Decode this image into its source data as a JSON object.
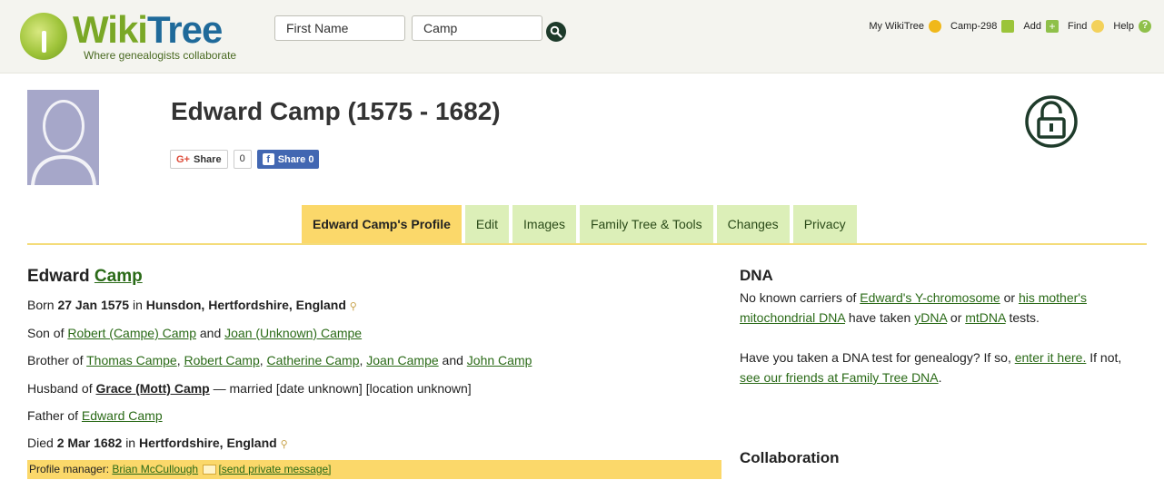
{
  "header": {
    "logo_text_wiki": "Wiki",
    "logo_text_tree": "Tree",
    "logo_tagline": "Where genealogists collaborate",
    "search": {
      "first_name_value": "First Name",
      "last_name_value": "Camp"
    },
    "nav": {
      "my_wikitree": "My WikiTree",
      "user": "Camp-298",
      "add": "Add",
      "find": "Find",
      "help": "Help"
    }
  },
  "profile": {
    "title": "Edward Camp (1575 - 1682)",
    "share": {
      "google_label": "Share",
      "google_count": "0",
      "facebook_label": "Share 0"
    }
  },
  "tabs": [
    {
      "label": "Edward Camp's Profile",
      "active": true
    },
    {
      "label": "Edit"
    },
    {
      "label": "Images"
    },
    {
      "label": "Family Tree & Tools"
    },
    {
      "label": "Changes"
    },
    {
      "label": "Privacy"
    }
  ],
  "person": {
    "first_name": "Edward",
    "last_name": "Camp",
    "born": {
      "prefix": "Born",
      "date": "27 Jan 1575",
      "in": "in",
      "place": "Hunsdon, Hertfordshire, England"
    },
    "son_of": {
      "prefix": "Son of",
      "father": "Robert (Campe) Camp",
      "and": "and",
      "mother": "Joan (Unknown) Campe"
    },
    "brother_of": {
      "prefix": "Brother of",
      "siblings": [
        "Thomas Campe",
        "Robert Camp",
        "Catherine Camp",
        "Joan Campe",
        "John Camp"
      ],
      "and": "and"
    },
    "husband_of": {
      "prefix": "Husband of",
      "spouse": "Grace (Mott) Camp",
      "details": "— married [date unknown] [location unknown]"
    },
    "father_of": {
      "prefix": "Father of",
      "child": "Edward Camp"
    },
    "died": {
      "prefix": "Died",
      "date": "2 Mar 1682",
      "in": "in",
      "place": "Hertfordshire, England"
    },
    "manager": {
      "prefix": "Profile manager:",
      "name": "Brian McCullough",
      "message_link": "[send private message]"
    }
  },
  "dna": {
    "heading": "DNA",
    "text_a": "No known carriers of",
    "link_y": "Edward's Y-chromosome",
    "text_b": "or",
    "link_mito": "his mother's mitochondrial DNA",
    "text_c": "have taken",
    "link_ydna": "yDNA",
    "text_d": "or",
    "link_mtdna": "mtDNA",
    "text_e": "tests.",
    "q_text": "Have you taken a DNA test for genealogy? If so,",
    "link_enter": "enter it here.",
    "q_text2": "If not,",
    "link_friends": "see our friends at Family Tree DNA",
    "q_end": "."
  },
  "collaboration": {
    "heading": "Collaboration"
  },
  "colors": {
    "accent_green": "#2a6a17",
    "tab_bg": "#dcefb8",
    "tab_active": "#fbd86a",
    "facebook": "#4267b2"
  }
}
